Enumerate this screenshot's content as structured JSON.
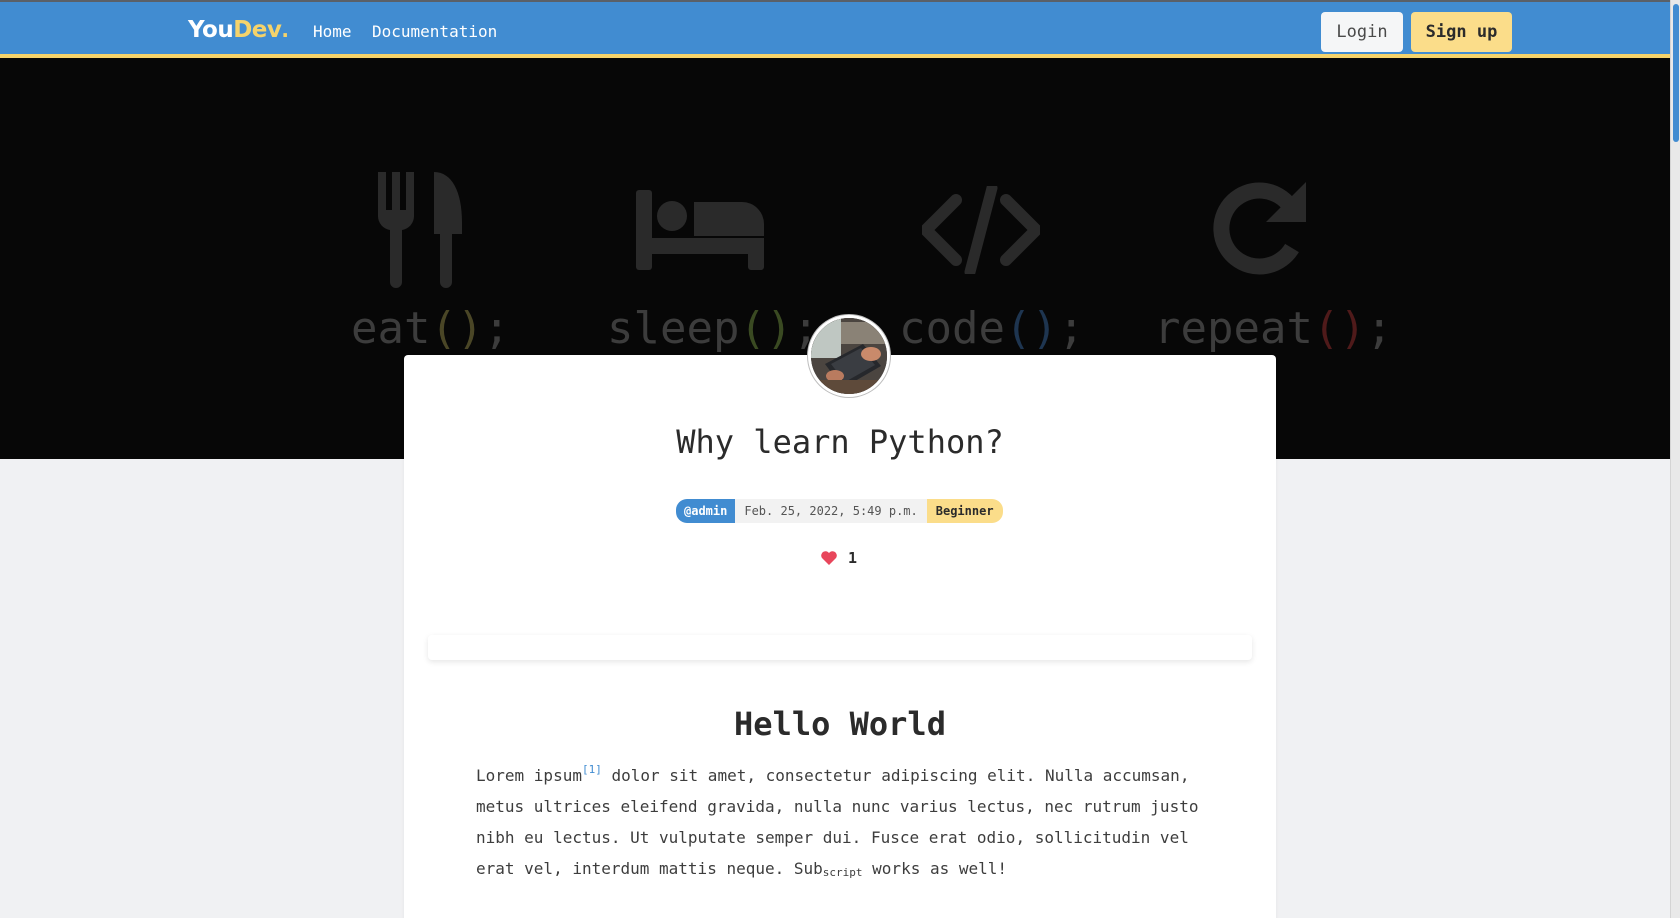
{
  "colors": {
    "primary": "#418cd1",
    "accent": "#f5d36b",
    "heart": "#e8465b",
    "hero_bg": "#070707"
  },
  "navbar": {
    "brand_you": "You",
    "brand_dev": "Dev",
    "brand_dot": ".",
    "links": [
      "Home",
      "Documentation"
    ],
    "login_label": "Login",
    "signup_label": "Sign up"
  },
  "hero": {
    "items": [
      {
        "icon": "fork-knife-icon",
        "word": "eat",
        "parens": "()",
        "semi": ";"
      },
      {
        "icon": "bed-icon",
        "word": "sleep",
        "parens": "()",
        "semi": ";"
      },
      {
        "icon": "code-icon",
        "word": "code",
        "parens": "()",
        "semi": ";"
      },
      {
        "icon": "redo-icon",
        "word": "repeat",
        "parens": "()",
        "semi": ";"
      }
    ]
  },
  "post": {
    "title": "Why learn Python?",
    "author": "@admin",
    "date": "Feb. 25, 2022, 5:49 p.m.",
    "level": "Beginner",
    "likes": "1",
    "section_heading": "Hello World",
    "body": {
      "part1": "Lorem ipsum",
      "footnote": "[1]",
      "part2": " dolor sit amet, consectetur adipiscing elit. Nulla accumsan, metus ultrices eleifend gravida, nulla nunc varius lectus, nec rutrum justo nibh eu lectus. Ut vulputate semper dui. Fusce erat odio, sollicitudin vel erat vel, interdum mattis neque. Sub",
      "sub": "script",
      "part3": " works as well!"
    }
  }
}
